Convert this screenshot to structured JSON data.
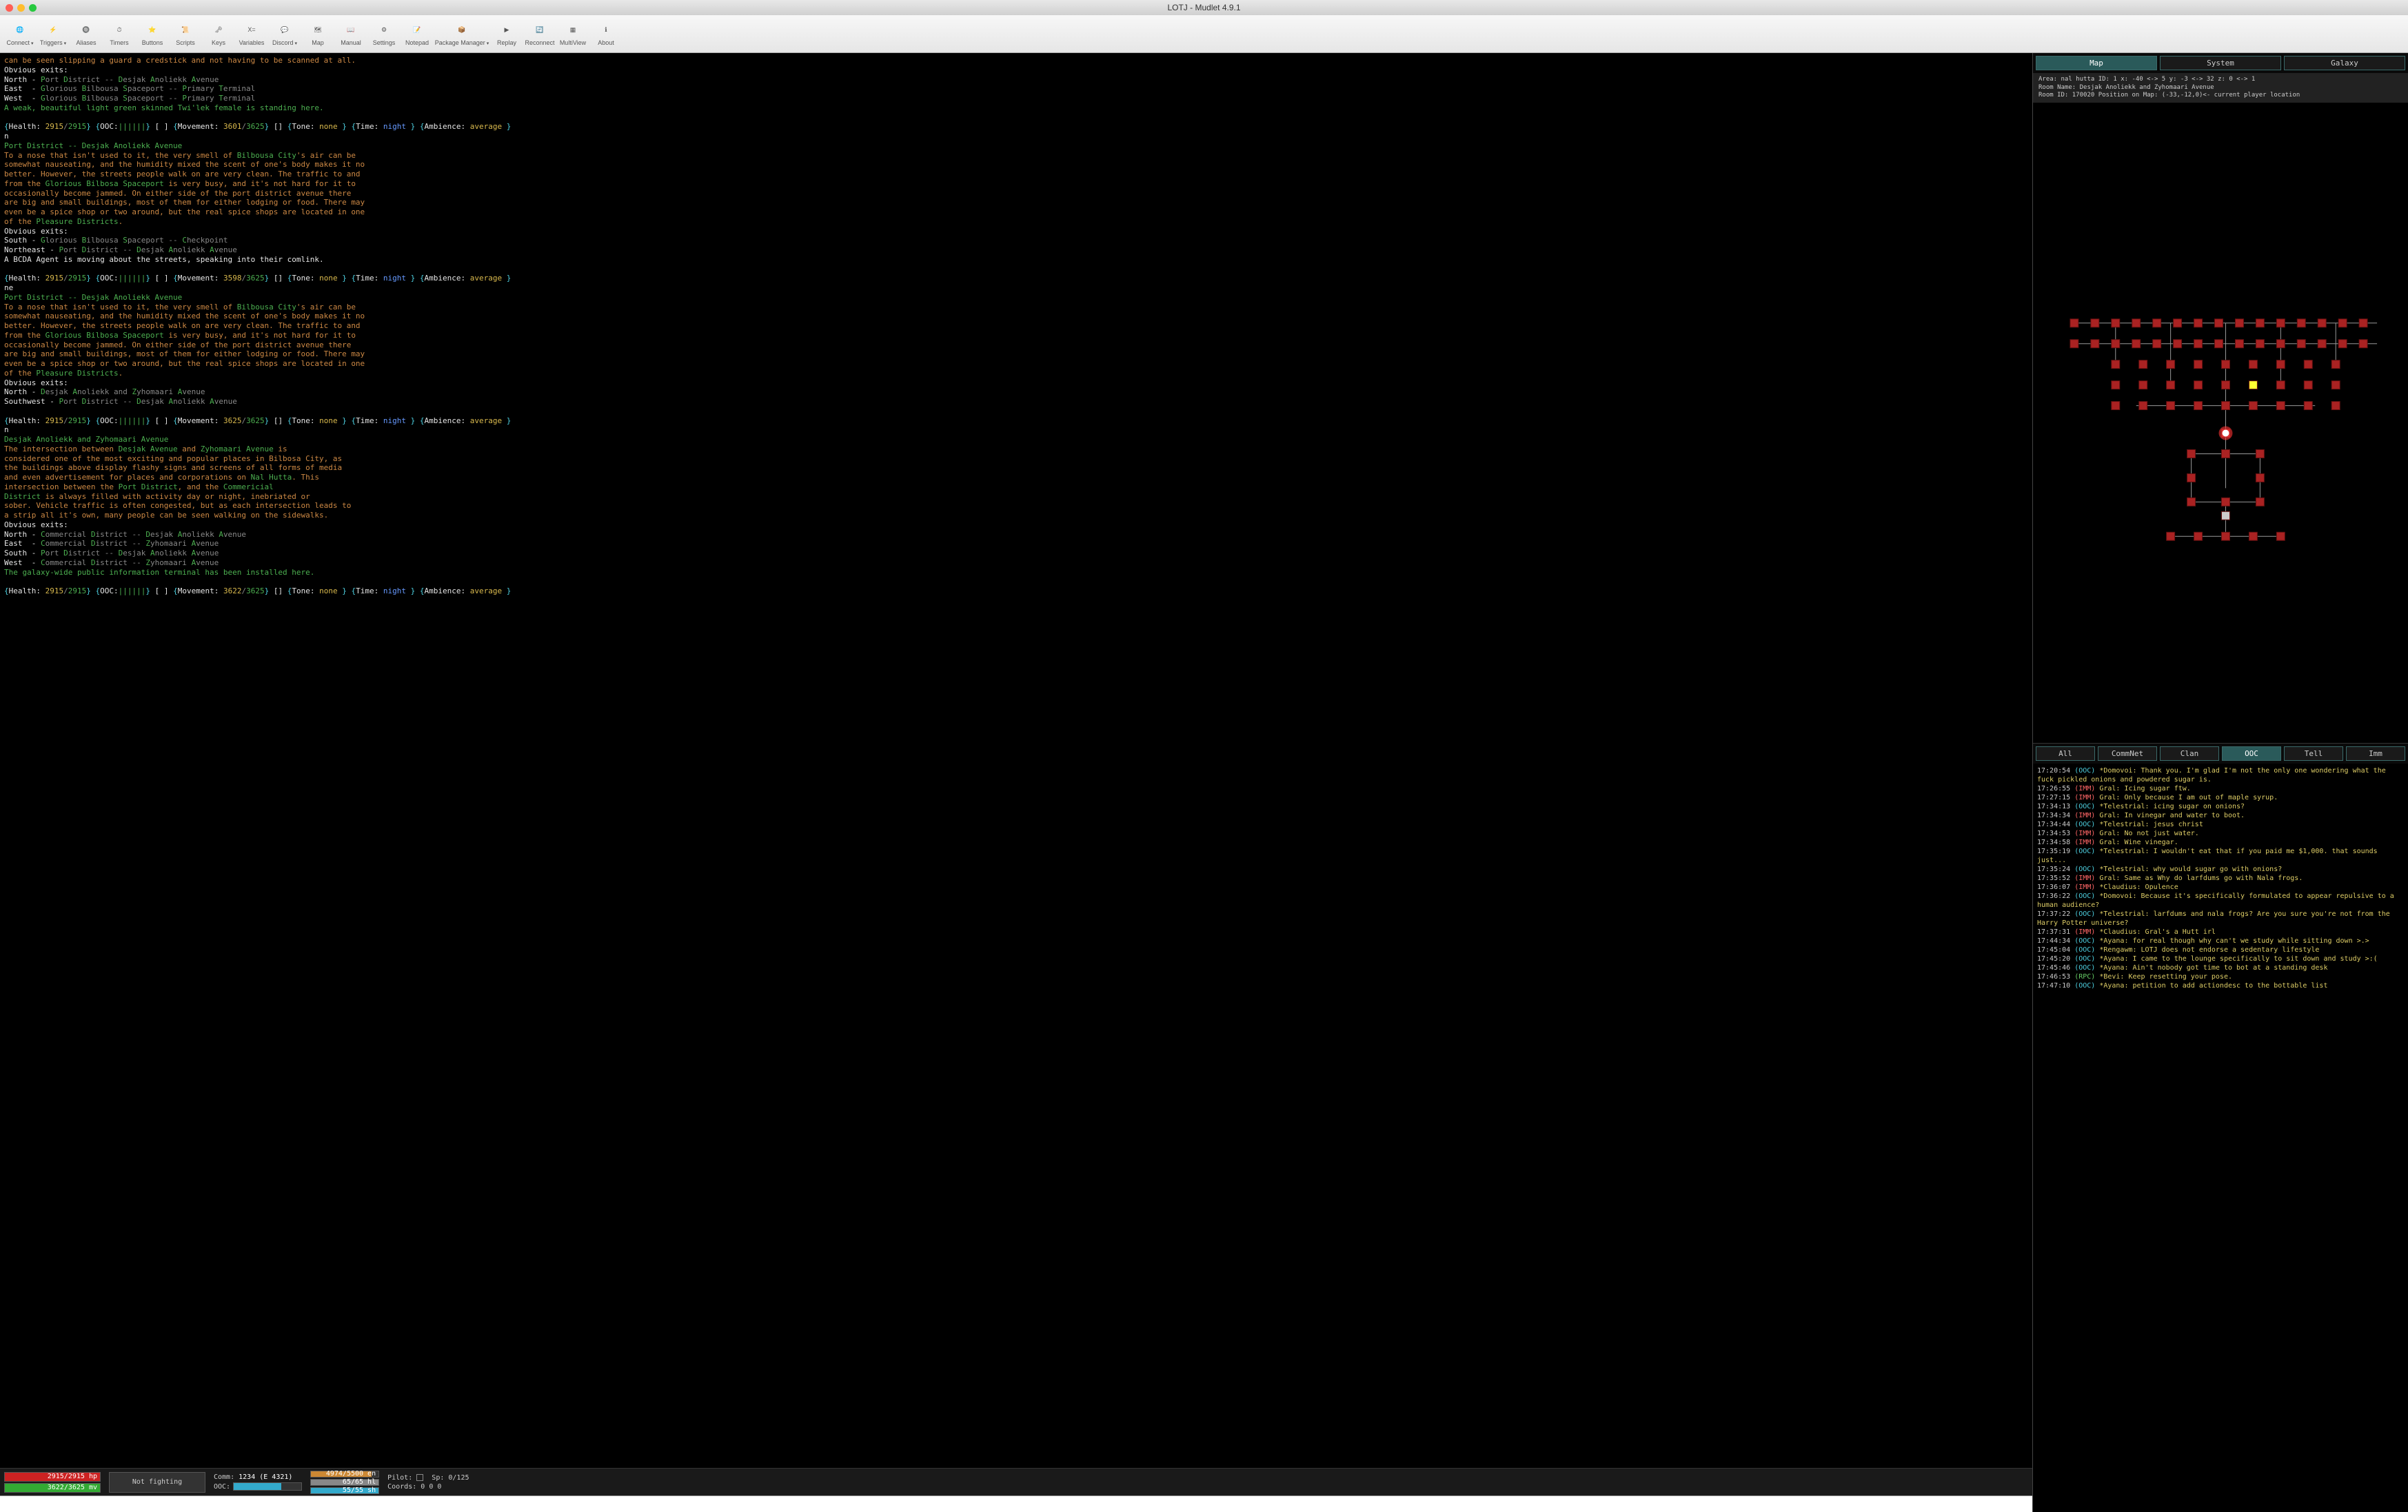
{
  "window": {
    "title": "LOTJ - Mudlet 4.9.1"
  },
  "toolbar": [
    {
      "label": "Connect",
      "icon": "🌐",
      "caret": true
    },
    {
      "label": "Triggers",
      "icon": "⚡",
      "caret": true
    },
    {
      "label": "Aliases",
      "icon": "🔘"
    },
    {
      "label": "Timers",
      "icon": "⏱"
    },
    {
      "label": "Buttons",
      "icon": "⭐"
    },
    {
      "label": "Scripts",
      "icon": "📜"
    },
    {
      "label": "Keys",
      "icon": "🗝"
    },
    {
      "label": "Variables",
      "icon": "X="
    },
    {
      "label": "Discord",
      "icon": "💬",
      "caret": true
    },
    {
      "label": "Map",
      "icon": "🗺"
    },
    {
      "label": "Manual",
      "icon": "📖"
    },
    {
      "label": "Settings",
      "icon": "⚙"
    },
    {
      "label": "Notepad",
      "icon": "📝"
    },
    {
      "label": "Package Manager",
      "icon": "📦",
      "caret": true,
      "wide": true
    },
    {
      "label": "Replay",
      "icon": "▶"
    },
    {
      "label": "Reconnect",
      "icon": "🔄"
    },
    {
      "label": "MultiView",
      "icon": "▦"
    },
    {
      "label": "About",
      "icon": "ℹ"
    }
  ],
  "map_tabs": [
    {
      "label": "Map",
      "active": true
    },
    {
      "label": "System",
      "active": false
    },
    {
      "label": "Galaxy",
      "active": false
    }
  ],
  "map_info": {
    "line1": "Area: nal hutta ID: 1 x: -40 <-> 5 y: -3 <-> 32 z: 0 <-> 1",
    "line2": "Room Name: Desjak Anoliekk and Zyhomaari Avenue",
    "line3": "Room ID: 170020 Position on Map: (-33,-12,0)<- current player location"
  },
  "chat_tabs": [
    {
      "label": "All",
      "active": false
    },
    {
      "label": "CommNet",
      "active": false
    },
    {
      "label": "Clan",
      "active": false
    },
    {
      "label": "OOC",
      "active": true
    },
    {
      "label": "Tell",
      "active": false
    },
    {
      "label": "Imm",
      "active": false
    }
  ],
  "status": {
    "hp": "2915/2915 hp",
    "mv": "3622/3625 mv",
    "fight": "Not fighting",
    "comm_label": "Comm:",
    "comm": "1234 (E 4321)",
    "ooc_label": "OOC:",
    "en": "4974/5500 en",
    "hl": "65/65 hl",
    "sh": "55/55 sh",
    "pilot_label": "Pilot:",
    "sp": "Sp: 0/125",
    "coords_label": "Coords:",
    "coords": "0 0 0"
  },
  "stat1": {
    "h": "2915",
    "hm": "2915",
    "m": "3601",
    "mm": "3625"
  },
  "stat2": {
    "h": "2915",
    "hm": "2915",
    "m": "3598",
    "mm": "3625"
  },
  "stat3": {
    "h": "2915",
    "hm": "2915",
    "m": "3625",
    "mm": "3625"
  },
  "stat4": {
    "h": "2915",
    "hm": "2915",
    "m": "3622",
    "mm": "3625"
  },
  "chat": [
    {
      "ts": "17:20:54",
      "ch": "OOC",
      "tx": "*Domovoi: Thank you. I'm glad I'm not the only one wondering what the fuck pickled onions and powdered sugar is."
    },
    {
      "ts": "17:26:55",
      "ch": "IMM",
      "tx": "Gral: Icing sugar ftw."
    },
    {
      "ts": "17:27:15",
      "ch": "IMM",
      "tx": "Gral: Only because I am out of maple syrup."
    },
    {
      "ts": "17:34:13",
      "ch": "OOC",
      "tx": "*Telestrial: icing sugar on onions?"
    },
    {
      "ts": "17:34:34",
      "ch": "IMM",
      "tx": "Gral: In vinegar and water to boot."
    },
    {
      "ts": "17:34:44",
      "ch": "OOC",
      "tx": "*Telestrial: jesus christ"
    },
    {
      "ts": "17:34:53",
      "ch": "IMM",
      "tx": "Gral: No not just water."
    },
    {
      "ts": "17:34:58",
      "ch": "IMM",
      "tx": "Gral: Wine vinegar."
    },
    {
      "ts": "17:35:19",
      "ch": "OOC",
      "tx": "*Telestrial: I wouldn't eat that if you paid me $1,000. that sounds just..."
    },
    {
      "ts": "17:35:24",
      "ch": "OOC",
      "tx": "*Telestrial: why would sugar go with onions?"
    },
    {
      "ts": "17:35:52",
      "ch": "IMM",
      "tx": "Gral: Same as Why do larfdums go with Nala frogs."
    },
    {
      "ts": "17:36:07",
      "ch": "IMM",
      "tx": "*Claudius: Opulence"
    },
    {
      "ts": "17:36:22",
      "ch": "OOC",
      "tx": "*Domovoi: Because it's specifically formulated to appear repulsive to a human audience?"
    },
    {
      "ts": "17:37:22",
      "ch": "OOC",
      "tx": "*Telestrial: larfdums and nala frogs? Are you sure you're not from the Harry Potter universe?"
    },
    {
      "ts": "17:37:31",
      "ch": "IMM",
      "tx": "*Claudius: Gral's a Hutt irl"
    },
    {
      "ts": "17:44:34",
      "ch": "OOC",
      "tx": "*Ayana: for real though why can't we study while sitting down >.>"
    },
    {
      "ts": "17:45:04",
      "ch": "OOC",
      "tx": "*Rengawm: LOTJ does not endorse a sedentary lifestyle"
    },
    {
      "ts": "17:45:20",
      "ch": "OOC",
      "tx": "*Ayana: I came to the lounge specifically to sit down and study >:("
    },
    {
      "ts": "17:45:46",
      "ch": "OOC",
      "tx": "*Ayana: Ain't nobody got time to bot at a standing desk"
    },
    {
      "ts": "17:46:53",
      "ch": "RPC",
      "tx": "*Bevi: Keep resetting your pose."
    },
    {
      "ts": "17:47:10",
      "ch": "OOC",
      "tx": "*Ayana: petition to add actiondesc to the bottable list"
    }
  ]
}
